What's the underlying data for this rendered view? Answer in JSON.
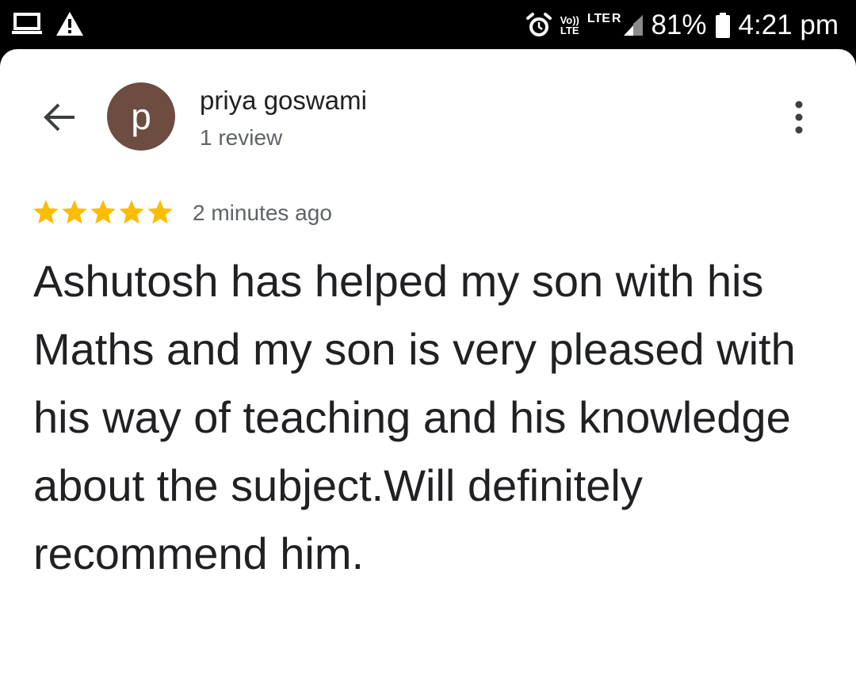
{
  "status_bar": {
    "battery_percent": "81%",
    "time": "4:21 pm",
    "volte_top": "Vo))",
    "volte_bottom": "LTE",
    "network_label": "LTE",
    "roaming_label": "R",
    "icons": [
      "laptop-icon",
      "warning-icon",
      "alarm-icon",
      "signal-icon",
      "battery-icon"
    ]
  },
  "header": {
    "avatar_letter": "p",
    "avatar_color": "#6d4c41",
    "reviewer_name": "priya goswami",
    "review_count": "1 review"
  },
  "review": {
    "rating": 5,
    "max_rating": 5,
    "star_color": "#fbbc04",
    "timestamp": "2 minutes ago",
    "text": "Ashutosh has helped my son with his Maths and my son is very pleased with his way of teaching and his knowledge about the subject.Will definitely recommend him."
  }
}
